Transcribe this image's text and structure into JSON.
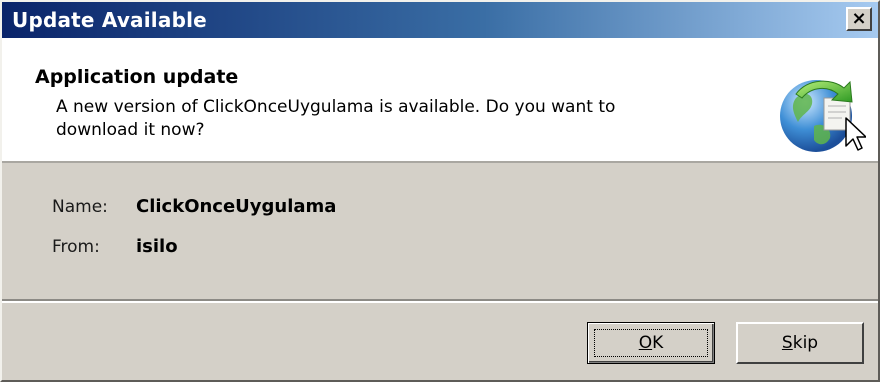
{
  "window": {
    "title": "Update Available",
    "close_glyph": "×"
  },
  "header": {
    "title": "Application update",
    "description": "A new version of ClickOnceUygulama is available. Do you want to download it now?",
    "icon": "globe-update-icon"
  },
  "details": {
    "name_label": "Name:",
    "name_value": "ClickOnceUygulama",
    "from_label": "From:",
    "from_value": "isilo"
  },
  "buttons": {
    "ok_mnemonic": "O",
    "ok_rest": "K",
    "skip_mnemonic": "S",
    "skip_rest": "kip"
  },
  "colors": {
    "titlebar_start": "#0a246a",
    "titlebar_end": "#a6caf0",
    "dialog_face": "#d4d0c8",
    "header_bg": "#ffffff"
  }
}
